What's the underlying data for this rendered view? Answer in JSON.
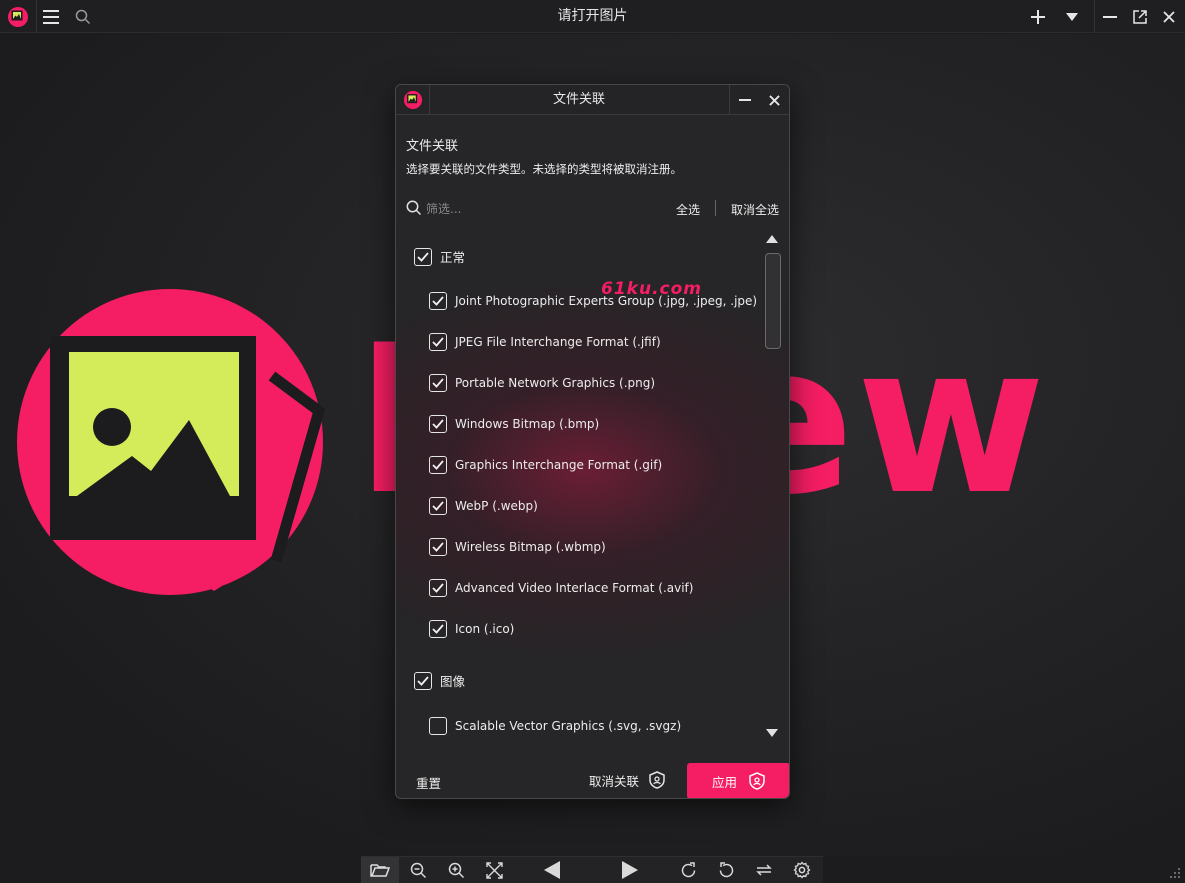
{
  "colors": {
    "accent": "#f51d63",
    "logo_green": "#d4ec5a",
    "background": "#1c1c1e"
  },
  "titlebar": {
    "title": "请打开图片",
    "icons": [
      "app-logo-icon",
      "menu-icon",
      "search-icon",
      "plus-icon",
      "dropdown-icon",
      "minimize-icon",
      "restore-icon",
      "close-icon"
    ]
  },
  "canvas": {
    "watermark_word": "Pview"
  },
  "dialog": {
    "title": "文件关联",
    "heading": "文件关联",
    "description": "选择要关联的文件类型。未选择的类型将被取消注册。",
    "search_placeholder": "筛选...",
    "select_all": "全选",
    "deselect_all": "取消全选",
    "watermark": "61ku.com",
    "groups": [
      {
        "label": "正常",
        "checked": true,
        "items": [
          {
            "label": "Joint Photographic Experts Group (.jpg, .jpeg, .jpe)",
            "checked": true
          },
          {
            "label": "JPEG File Interchange Format (.jfif)",
            "checked": true
          },
          {
            "label": "Portable Network Graphics (.png)",
            "checked": true
          },
          {
            "label": "Windows Bitmap (.bmp)",
            "checked": true
          },
          {
            "label": "Graphics Interchange Format (.gif)",
            "checked": true
          },
          {
            "label": "WebP (.webp)",
            "checked": true
          },
          {
            "label": "Wireless Bitmap (.wbmp)",
            "checked": true
          },
          {
            "label": "Advanced Video Interlace Format (.avif)",
            "checked": true
          },
          {
            "label": "Icon (.ico)",
            "checked": true
          }
        ]
      },
      {
        "label": "图像",
        "checked": true,
        "items": [
          {
            "label": "Scalable Vector Graphics (.svg, .svgz)",
            "checked": false
          }
        ]
      }
    ],
    "footer": {
      "reset": "重置",
      "unassociate": "取消关联",
      "apply": "应用"
    }
  },
  "bottombar": {
    "icons": [
      "open-folder-icon",
      "zoom-out-icon",
      "zoom-in-icon",
      "fit-window-icon",
      "previous-icon",
      "next-icon",
      "rotate-clockwise-icon",
      "rotate-counterclockwise-icon",
      "flip-icon",
      "settings-icon"
    ]
  }
}
